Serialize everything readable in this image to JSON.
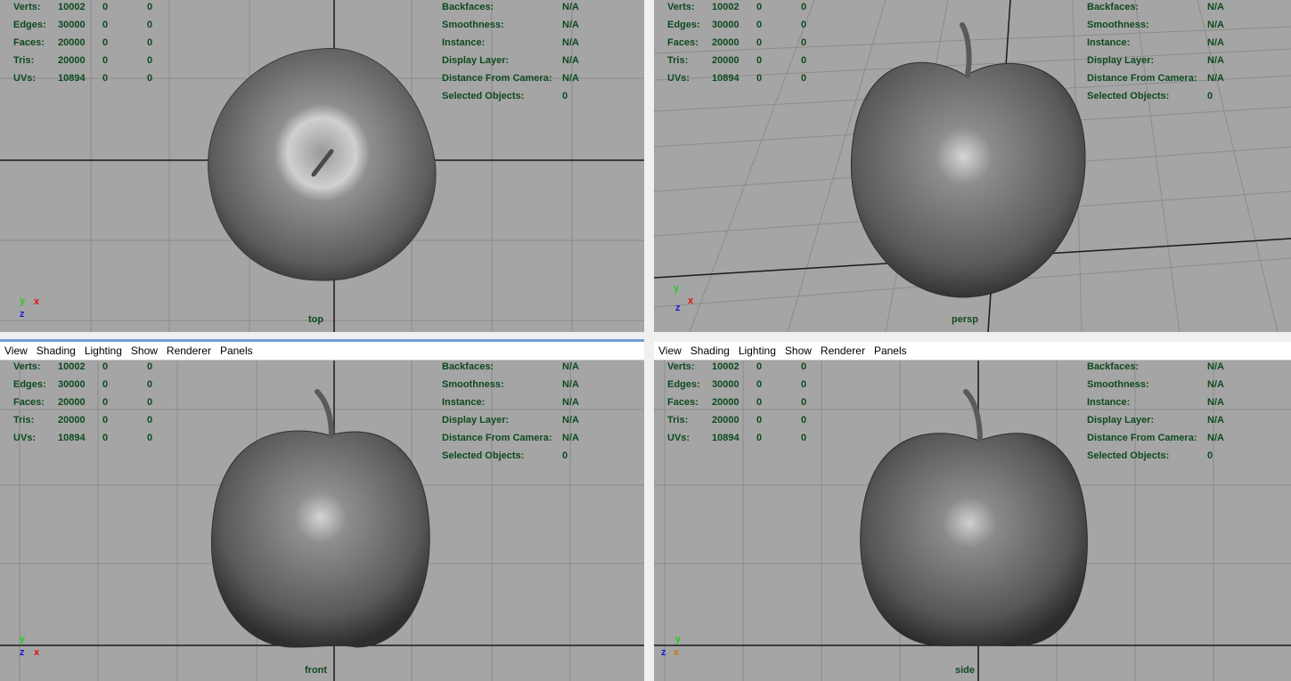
{
  "menu": [
    "View",
    "Shading",
    "Lighting",
    "Show",
    "Renderer",
    "Panels"
  ],
  "stats_left": {
    "rows": [
      {
        "label": "Verts:",
        "v1": "10002",
        "v2": "0",
        "v3": "0"
      },
      {
        "label": "Edges:",
        "v1": "30000",
        "v2": "0",
        "v3": "0"
      },
      {
        "label": "Faces:",
        "v1": "20000",
        "v2": "0",
        "v3": "0"
      },
      {
        "label": "Tris:",
        "v1": "20000",
        "v2": "0",
        "v3": "0"
      },
      {
        "label": "UVs:",
        "v1": "10894",
        "v2": "0",
        "v3": "0"
      }
    ]
  },
  "stats_right": {
    "rows": [
      {
        "label": "Backfaces:",
        "value": "N/A"
      },
      {
        "label": "Smoothness:",
        "value": "N/A"
      },
      {
        "label": "Instance:",
        "value": "N/A"
      },
      {
        "label": "Display Layer:",
        "value": "N/A"
      },
      {
        "label": "Distance From Camera:",
        "value": "N/A"
      },
      {
        "label": "Selected Objects:",
        "value": "0"
      }
    ]
  },
  "viewports": [
    {
      "name": "top",
      "axes": [
        "y",
        "x",
        "z"
      ]
    },
    {
      "name": "persp",
      "axes": [
        "y",
        "x",
        "z"
      ]
    },
    {
      "name": "front",
      "axes": [
        "y",
        "z",
        "x"
      ]
    },
    {
      "name": "side",
      "axes": [
        "y",
        "z",
        "x"
      ]
    }
  ],
  "colors": {
    "viewport_bg": "#a5a5a5",
    "grid": "#8a8a8a",
    "axis_line": "#1a1a1a",
    "hud_text": "#0d4a1e",
    "axis_x": "#e01010",
    "axis_y": "#22cc22",
    "axis_z": "#1a1add"
  }
}
